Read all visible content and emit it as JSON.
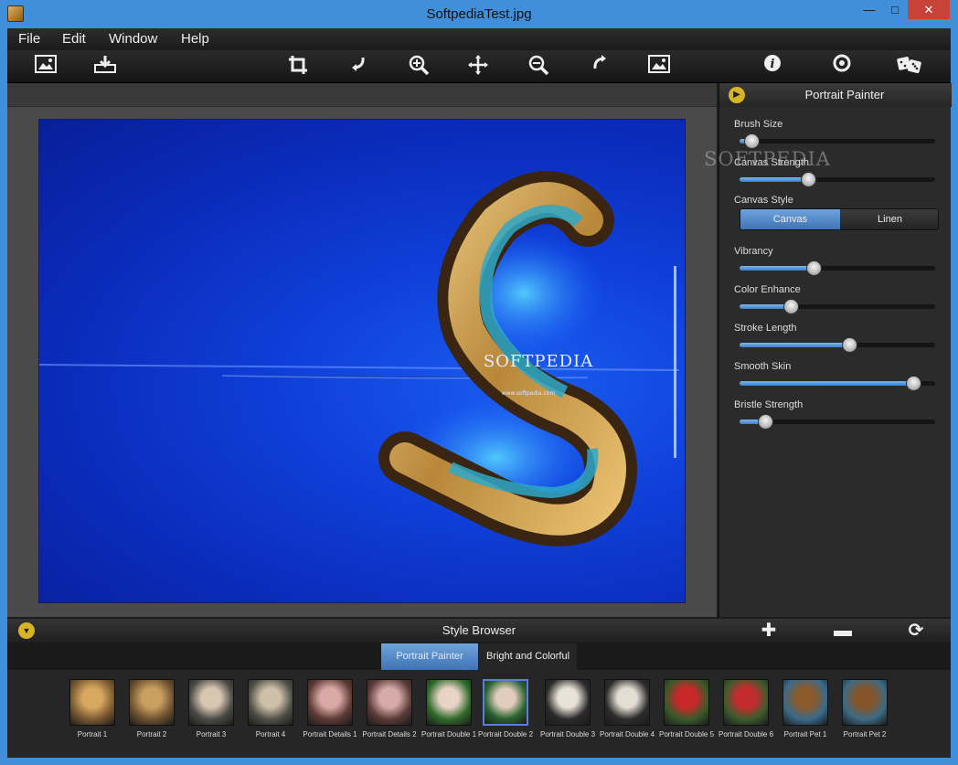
{
  "window": {
    "title": "SoftpediaTest.jpg",
    "controls": {
      "minimize": "—",
      "maximize": "□",
      "close": "✕"
    }
  },
  "menu": [
    "File",
    "Edit",
    "Window",
    "Help"
  ],
  "toolbar": {
    "icons": [
      "open-image-icon",
      "save-icon",
      "crop-icon",
      "rotate-left-icon",
      "zoom-in-icon",
      "pan-icon",
      "zoom-out-icon",
      "rotate-right-icon",
      "fit-image-icon",
      "info-icon",
      "settings-icon",
      "random-dice-icon"
    ]
  },
  "photo": {
    "text": "SOFTPEDIA",
    "subtext": "www.softpedia.com"
  },
  "panel": {
    "title": "Portrait Painter",
    "sliders": [
      {
        "label": "Brush Size",
        "value": 0.06
      },
      {
        "label": "Canvas Strength",
        "value": 0.35
      },
      {
        "label": "Vibrancy",
        "value": 0.38
      },
      {
        "label": "Color Enhance",
        "value": 0.26
      },
      {
        "label": "Stroke Length",
        "value": 0.56
      },
      {
        "label": "Smooth Skin",
        "value": 0.89
      },
      {
        "label": "Bristle Strength",
        "value": 0.13
      }
    ],
    "canvas_style": {
      "label": "Canvas Style",
      "options": [
        "Canvas",
        "Linen"
      ],
      "selected": "Canvas"
    }
  },
  "watermark": {
    "text": "SOFTPEDIA",
    "sub": "www.softpedia.com"
  },
  "style_browser": {
    "title": "Style Browser",
    "tabs": [
      "Portrait Painter",
      "Bright and Colorful"
    ],
    "active_tab": "Portrait Painter",
    "thumbs": [
      {
        "label": "Portrait 1",
        "c1": "#7a5a32",
        "c2": "#d8a860"
      },
      {
        "label": "Portrait 2",
        "c1": "#6e5230",
        "c2": "#caa061"
      },
      {
        "label": "Portrait 3",
        "c1": "#4a4a46",
        "c2": "#d7c6b0"
      },
      {
        "label": "Portrait 4",
        "c1": "#505048",
        "c2": "#cdbfa8"
      },
      {
        "label": "Portrait Details 1",
        "c1": "#5e3a36",
        "c2": "#d9a9a6"
      },
      {
        "label": "Portrait Details 2",
        "c1": "#5a3a38",
        "c2": "#d5aaa8"
      },
      {
        "label": "Portrait Double 1",
        "c1": "#2f6a2a",
        "c2": "#e8d3c4"
      },
      {
        "label": "Portrait Double 2",
        "c1": "#2a6330",
        "c2": "#e2cdbd"
      },
      {
        "label": "Portrait Double 3",
        "c1": "#2a2a2a",
        "c2": "#e9e2d9"
      },
      {
        "label": "Portrait Double 4",
        "c1": "#2c2c2c",
        "c2": "#e4ddd3"
      },
      {
        "label": "Portrait Double 5",
        "c1": "#3a5a2a",
        "c2": "#c8282a"
      },
      {
        "label": "Portrait Double 6",
        "c1": "#3d5c2d",
        "c2": "#c42b2e"
      },
      {
        "label": "Portrait Pet 1",
        "c1": "#3a6a8a",
        "c2": "#8a5a2a"
      },
      {
        "label": "Portrait Pet 2",
        "c1": "#3c6a86",
        "c2": "#84552a"
      }
    ],
    "selected_index": 7,
    "controls": {
      "add": "✚",
      "remove": "▬",
      "reset": "⟳"
    }
  }
}
